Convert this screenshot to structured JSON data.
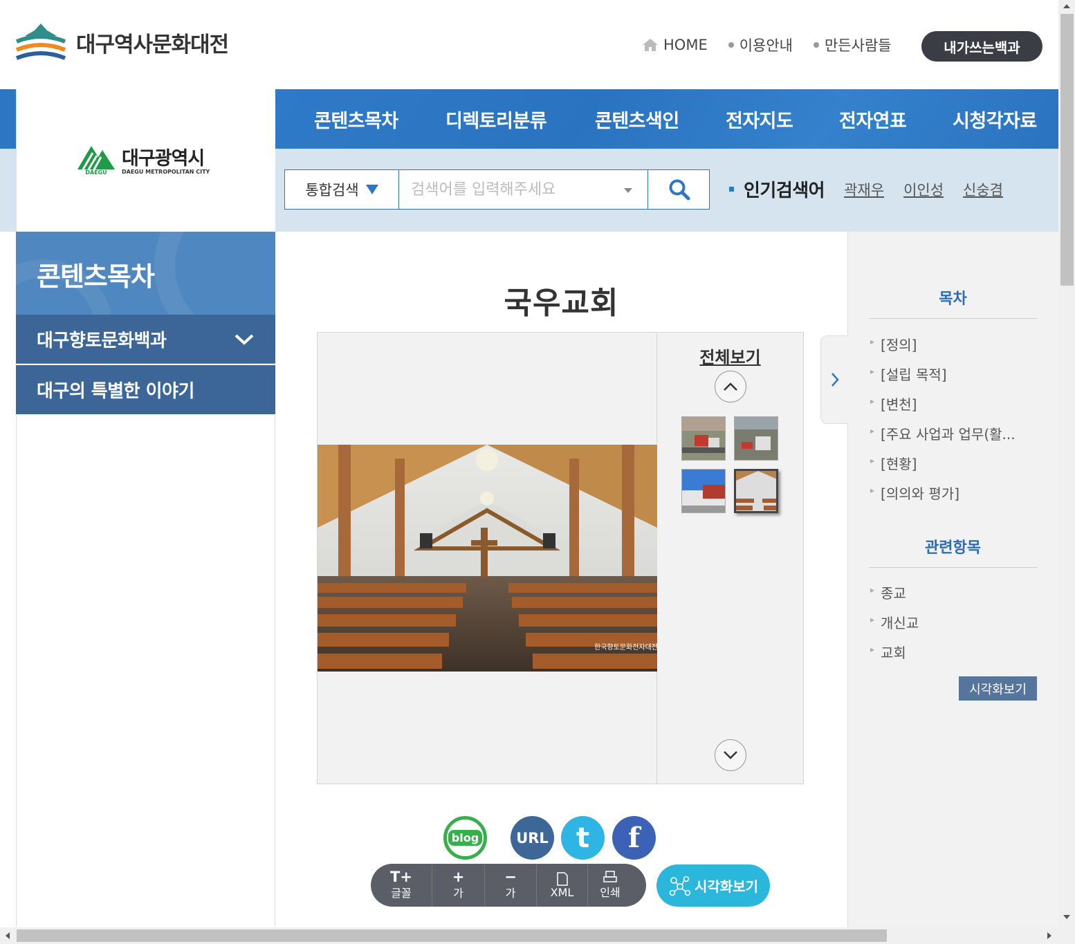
{
  "header": {
    "site_title": "대구역사문화대전",
    "util_links": [
      "HOME",
      "이용안내",
      "만든사람들"
    ],
    "write_button": "내가쓰는백과"
  },
  "gnb": {
    "menus": [
      "콘텐츠목차",
      "디렉토리분류",
      "콘텐츠색인",
      "전자지도",
      "전자연표",
      "시청각자료"
    ]
  },
  "city_logo": {
    "name": "대구광역시",
    "sub": "DAEGU METROPOLITAN CITY",
    "mark_text": "DAEGU"
  },
  "search": {
    "type": "통합검색",
    "placeholder": "검색어를 입력해주세요",
    "popular_label": "인기검색어",
    "popular_keywords": [
      "곽재우",
      "이인성",
      "신숭겸"
    ]
  },
  "sidebar": {
    "title": "콘텐츠목차",
    "items": [
      "대구향토문화백과",
      "대구의 특별한 이야기"
    ]
  },
  "article": {
    "title": "국우교회",
    "view_all": "전체보기",
    "photo_watermark": "한국향토문화전자대전"
  },
  "share": {
    "blog": "blog",
    "url": "URL",
    "twitter": "t",
    "facebook": "f"
  },
  "tools": {
    "font": "글꼴",
    "font_icon": "T+",
    "zoom_in": "가",
    "zoom_in_icon": "+",
    "zoom_out": "가",
    "zoom_out_icon": "−",
    "xml": "XML",
    "print": "인쇄",
    "visual": "시각화보기"
  },
  "right_panel": {
    "toc_title": "목차",
    "toc_items": [
      "[정의]",
      "[설립 목적]",
      "[변천]",
      "[주요 사업과 업무(활...",
      "[현황]",
      "[의의와 평가]"
    ],
    "related_title": "관련항목",
    "related_items": [
      "종교",
      "개신교",
      "교회"
    ],
    "visual_button": "시각화보기"
  },
  "colors": {
    "primary_blue": "#2c76c4",
    "light_band": "#d6e4ef",
    "sidebar_dark": "#3b6697",
    "visual_cyan": "#2bb6db"
  }
}
